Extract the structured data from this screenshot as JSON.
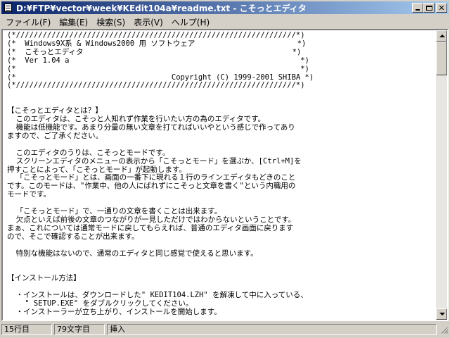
{
  "window": {
    "title": "D:¥FTP¥vector¥week¥KEdit104a¥readme.txt - こそっとエディタ"
  },
  "menu": [
    "ファイル(F)",
    "編集(E)",
    "検索(S)",
    "表示(V)",
    "ヘルプ(H)"
  ],
  "editor": {
    "lines": [
      "(*///////////////////////////////////////////////////////////////*)",
      "(*  Windows9X系 & Windows2000 用 ソフトウェア                       *)",
      "(*  こそっとエディタ                                               *)",
      "(*  Ver 1.04 a                                                    *)",
      "(*                                                                *)",
      "(*                                   Copyright (C) 1999-2001 SHIBA *)",
      "(*///////////////////////////////////////////////////////////////*)",
      "",
      "",
      "【こそっとエディタとは？】",
      "  このエディタは、こそっと人知れず作業を行いたい方の為のエディタです。",
      "  機能は低機能です。あまり分量の無い文章を打てればいいやという感じで作ってあり",
      "ますので、ご了承ください。",
      "",
      "  このエディタのうりは、こそっとモードです。",
      "  スクリーンエディタのメニューの表示から「こそっとモード」を選ぶか、[Ctrl+M]を",
      "押すことによって、「こそっとモード」が起動します。",
      "  「こそっとモード」とは、画面の一番下に現れる１行のラインエディタもどきのこと",
      "です。このモードは、\"作業中、他の人にばれずにこそっと文章を書く\"という内職用の",
      "モードです。",
      "",
      "  「こそっとモード」で、一通りの文章を書くことは出来ます。",
      "  欠点といえば前後の文章のつながりが一見しただけではわからないということです。",
      "まぁ、これについては通常モードに戻してもらえれば、普通のエディタ画面に戻ります",
      "ので、そこで確認することが出来ます。",
      "",
      "  特別な機能はないので、通常のエディタと同じ感覚で使えると思います。",
      "",
      "",
      "【インストール方法】",
      "",
      "  ・インストールは、ダウンロードした\" KEDIT104.LZH\" を解凍して中に入っている、",
      "    \" SETUP.EXE\" をダブルクリックしてください。",
      "  ・インストーラーが立ち上がり、インストールを開始します。"
    ]
  },
  "status": {
    "line": "15行目",
    "column": "79文字目",
    "mode": "挿入"
  }
}
